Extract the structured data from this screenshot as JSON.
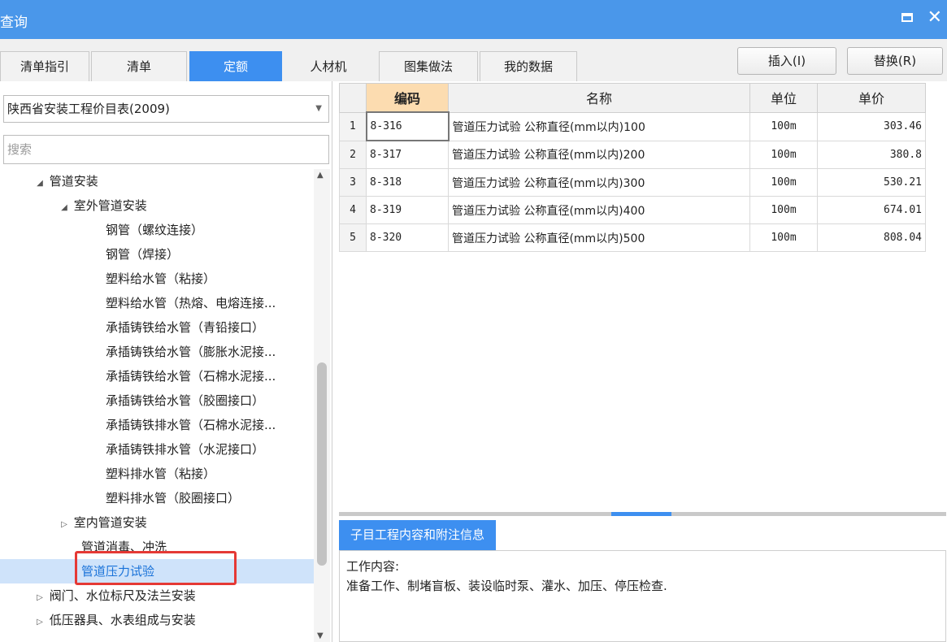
{
  "window": {
    "title": "查询"
  },
  "tabs": [
    "清单指引",
    "清单",
    "定额",
    "人材机",
    "图集做法",
    "我的数据"
  ],
  "buttons": {
    "insert": "插入(I)",
    "replace": "替换(R)"
  },
  "library_select": {
    "value": "陕西省安装工程价目表(2009)"
  },
  "search": {
    "placeholder": "搜索"
  },
  "tree": [
    {
      "label": "管道安装",
      "toggle": "◢"
    },
    {
      "label": "室外管道安装",
      "toggle": "◢"
    },
    {
      "label": "钢管（螺纹连接）",
      "toggle": ""
    },
    {
      "label": "钢管（焊接）",
      "toggle": ""
    },
    {
      "label": "塑料给水管（粘接）",
      "toggle": ""
    },
    {
      "label": "塑料给水管（热熔、电熔连接...",
      "toggle": ""
    },
    {
      "label": "承插铸铁给水管（青铅接口）",
      "toggle": ""
    },
    {
      "label": "承插铸铁给水管（膨胀水泥接...",
      "toggle": ""
    },
    {
      "label": "承插铸铁给水管（石棉水泥接...",
      "toggle": ""
    },
    {
      "label": "承插铸铁给水管（胶圈接口）",
      "toggle": ""
    },
    {
      "label": "承插铸铁排水管（石棉水泥接...",
      "toggle": ""
    },
    {
      "label": "承插铸铁排水管（水泥接口）",
      "toggle": ""
    },
    {
      "label": "塑料排水管（粘接）",
      "toggle": ""
    },
    {
      "label": "塑料排水管（胶圈接口）",
      "toggle": ""
    },
    {
      "label": "室内管道安装",
      "toggle": "▷"
    },
    {
      "label": "管道消毒、冲洗",
      "toggle": ""
    },
    {
      "label": "管道压力试验",
      "toggle": ""
    },
    {
      "label": "阀门、水位标尺及法兰安装",
      "toggle": "▷"
    },
    {
      "label": "低压器具、水表组成与安装",
      "toggle": "▷"
    }
  ],
  "table": {
    "headers": {
      "code": "编码",
      "name": "名称",
      "unit": "单位",
      "price": "单价"
    },
    "rows": [
      {
        "n": "1",
        "code": "8-316",
        "name": "管道压力试验 公称直径(mm以内)100",
        "unit": "100m",
        "price": "303.46"
      },
      {
        "n": "2",
        "code": "8-317",
        "name": "管道压力试验 公称直径(mm以内)200",
        "unit": "100m",
        "price": "380.8"
      },
      {
        "n": "3",
        "code": "8-318",
        "name": "管道压力试验 公称直径(mm以内)300",
        "unit": "100m",
        "price": "530.21"
      },
      {
        "n": "4",
        "code": "8-319",
        "name": "管道压力试验 公称直径(mm以内)400",
        "unit": "100m",
        "price": "674.01"
      },
      {
        "n": "5",
        "code": "8-320",
        "name": "管道压力试验 公称直径(mm以内)500",
        "unit": "100m",
        "price": "808.04"
      }
    ]
  },
  "detail": {
    "tab": "子目工程内容和附注信息",
    "line1": "工作内容:",
    "line2": "准备工作、制堵盲板、装设临时泵、灌水、加压、停压检查."
  },
  "colors": {
    "accent": "#3d8ff0",
    "titlebar": "#4a97ea",
    "highlight_box": "#e53935",
    "selected_row": "#cfe3fa"
  }
}
